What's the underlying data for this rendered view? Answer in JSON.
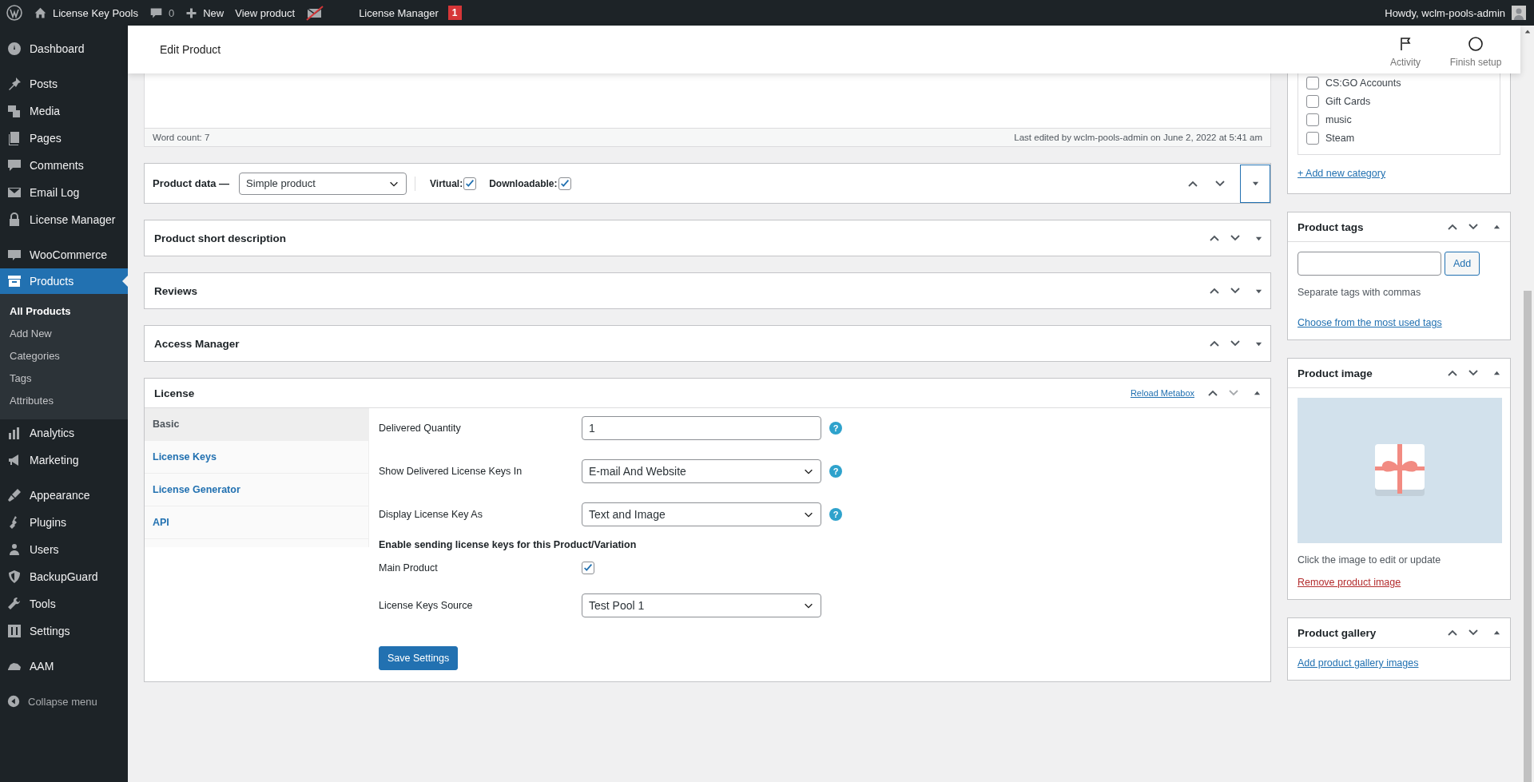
{
  "admin_bar": {
    "site_title": "License Key Pools",
    "comments_count": "0",
    "new_label": "New",
    "view_label": "View product",
    "license_manager_label": "License Manager",
    "badge": "1",
    "howdy": "Howdy, wclm-pools-admin"
  },
  "sidebar": {
    "groups": [
      [
        {
          "label": "Dashboard",
          "selected": false
        }
      ],
      [
        {
          "label": "Posts",
          "selected": false
        },
        {
          "label": "Media",
          "selected": false
        },
        {
          "label": "Pages",
          "selected": false
        },
        {
          "label": "Comments",
          "selected": false
        },
        {
          "label": "Email Log",
          "selected": false
        },
        {
          "label": "License Manager",
          "selected": false
        }
      ],
      [
        {
          "label": "WooCommerce",
          "selected": false
        },
        {
          "label": "Products",
          "selected": true,
          "children": [
            {
              "label": "All Products",
              "selected": true
            },
            {
              "label": "Add New",
              "selected": false
            },
            {
              "label": "Categories",
              "selected": false
            },
            {
              "label": "Tags",
              "selected": false
            },
            {
              "label": "Attributes",
              "selected": false
            }
          ]
        },
        {
          "label": "Analytics",
          "selected": false
        },
        {
          "label": "Marketing",
          "selected": false
        }
      ],
      [
        {
          "label": "Appearance",
          "selected": false
        },
        {
          "label": "Plugins",
          "selected": false
        },
        {
          "label": "Users",
          "selected": false
        },
        {
          "label": "BackupGuard",
          "selected": false
        },
        {
          "label": "Tools",
          "selected": false
        },
        {
          "label": "Settings",
          "selected": false
        }
      ],
      [
        {
          "label": "AAM",
          "selected": false
        }
      ]
    ],
    "collapse_label": "Collapse menu"
  },
  "header": {
    "title": "Edit Product",
    "actions": [
      {
        "label": "Activity"
      },
      {
        "label": "Finish setup"
      }
    ]
  },
  "editor": {
    "word_count": "Word count: 7",
    "last_edited": "Last edited by wclm-pools-admin on June 2, 2022 at 5:41 am"
  },
  "product_data": {
    "label": "Product data —",
    "type_select": "Simple product",
    "virtual": {
      "label": "Virtual:",
      "checked": true
    },
    "downloadable": {
      "label": "Downloadable:",
      "checked": true
    },
    "expanded": false
  },
  "panels": [
    {
      "title": "Product short description",
      "expanded": false
    },
    {
      "title": "Reviews",
      "expanded": false
    },
    {
      "title": "Access Manager",
      "expanded": false
    }
  ],
  "license": {
    "title": "License",
    "reload_link": "Reload Metabox",
    "expanded": true,
    "tabs": [
      {
        "label": "Basic",
        "selected": true
      },
      {
        "label": "License Keys",
        "selected": false
      },
      {
        "label": "License Generator",
        "selected": false
      },
      {
        "label": "API",
        "selected": false
      }
    ],
    "fields": [
      {
        "kind": "input",
        "label": "Delivered Quantity",
        "value": "1",
        "help": "?"
      },
      {
        "kind": "select",
        "label": "Show Delivered License Keys In",
        "value": "E-mail And Website",
        "help": "?"
      },
      {
        "kind": "select",
        "label": "Display License Key As",
        "value": "Text and Image",
        "help": "?"
      },
      {
        "kind": "heading",
        "label": "Enable sending license keys for this Product/Variation"
      },
      {
        "kind": "checkbox",
        "label": "Main Product",
        "checked": true
      },
      {
        "kind": "select",
        "label": "License Keys Source",
        "value": "Test Pool 1"
      }
    ],
    "save_button": "Save Settings"
  },
  "categories": {
    "items": [
      {
        "label": "CS:GO Accounts",
        "checked": false
      },
      {
        "label": "Gift Cards",
        "checked": false
      },
      {
        "label": "music",
        "checked": false
      },
      {
        "label": "Steam",
        "checked": false
      }
    ],
    "add_link": "+ Add new category"
  },
  "product_tags": {
    "title": "Product tags",
    "add_button": "Add",
    "hint": "Separate tags with commas",
    "link": "Choose from the most used tags",
    "expanded": true
  },
  "product_image": {
    "title": "Product image",
    "hint": "Click the image to edit or update",
    "remove_link": "Remove product image",
    "expanded": true
  },
  "product_gallery": {
    "title": "Product gallery",
    "link": "Add product gallery images",
    "expanded": true
  }
}
